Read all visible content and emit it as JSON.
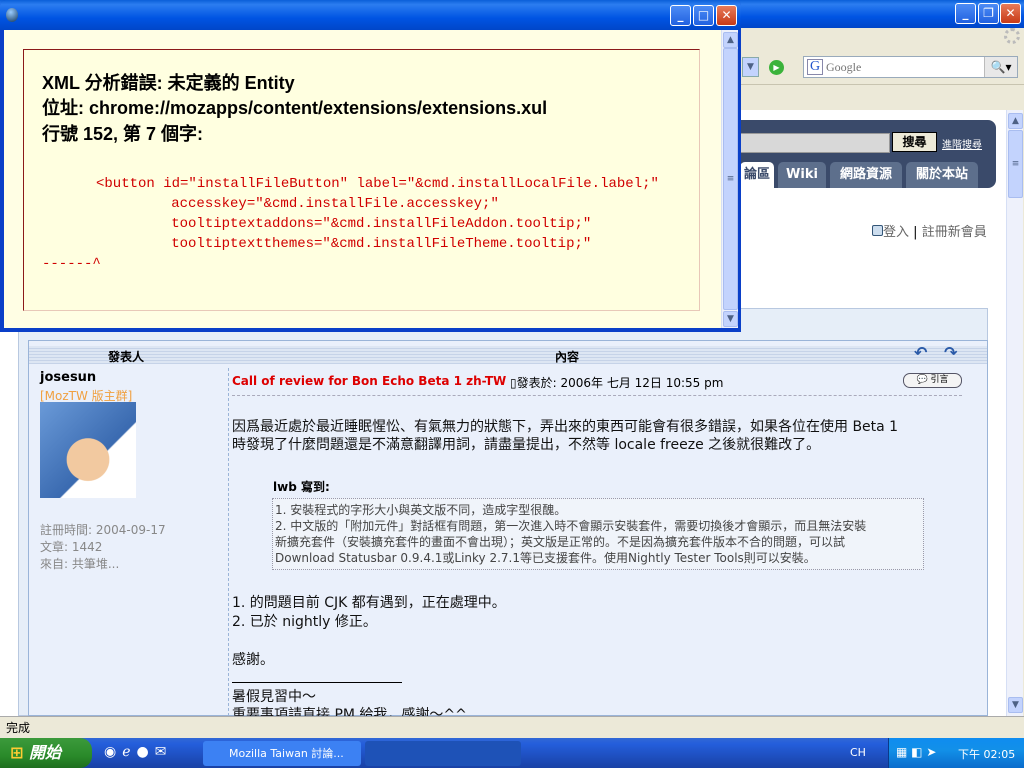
{
  "browser": {
    "search_placeholder": "Google",
    "status_text": "完成"
  },
  "site": {
    "search_button": "搜尋",
    "advanced_search": "進階搜尋",
    "tabs": [
      "論區",
      "Wiki",
      "網路資源",
      "關於本站"
    ],
    "login": "登入",
    "separator": "|",
    "register": "註冊新會員"
  },
  "forum": {
    "col_author": "發表人",
    "col_content": "內容",
    "author": {
      "name": "josesun",
      "rank": "[MozTW 版主群]",
      "joined": "註冊時間: 2004-09-17",
      "posts": "文章: 1442",
      "location": "來自: 共筆堆..."
    },
    "post": {
      "title": "Call of review for Bon Echo Beta 1 zh-TW",
      "posted": "發表於: 2006年 七月 12日 10:55 pm",
      "quote_button": "引言",
      "body": [
        "因爲最近處於最近睡眠惺忪、有氣無力的狀態下，弄出來的東西可能會有很多錯誤，如果各位在使用 Beta 1",
        "時發現了什麼問題還是不滿意翻譯用詞，請盡量提出，不然等 locale freeze 之後就很難改了。"
      ],
      "quote_author": "lwb 寫到:",
      "quote_lines": [
        "1. 安裝程式的字形大小與英文版不同，造成字型很醜。",
        "2. 中文版的「附加元件」對話框有問題，第一次進入時不會顯示安裝套件，需要切換後才會顯示，而且無法安裝",
        "新擴充套件（安裝擴充套件的畫面不會出現）；英文版是正常的。不是因為擴充套件版本不合的問題，可以試",
        "Download Statusbar 0.9.4.1或Linky 2.7.1等已支援套件。使用Nightly Tester Tools則可以安裝。"
      ],
      "reply_lines": [
        "1. 的問題目前 CJK 都有遇到，正在處理中。",
        "2. 已於 nightly 修正。"
      ],
      "thanks": "感謝。",
      "signature": [
        "暑假見習中～",
        "重要事項請直接 PM 給我，感謝～^^"
      ]
    }
  },
  "dialog": {
    "error_title": "XML 分析錯誤: 未定義的 Entity",
    "location": "位址: chrome://mozapps/content/extensions/extensions.xul",
    "line_info": "行號 152, 第 7 個字:",
    "code_lines": [
      "<button id=\"installFileButton\" label=\"&cmd.installLocalFile.label;\"",
      "        accesskey=\"&cmd.installFile.accesskey;\"",
      "        tooltiptextaddons=\"&cmd.installFileAddon.tooltip;\"",
      "        tooltiptextthemes=\"&cmd.installFileTheme.tooltip;\""
    ],
    "pointer": "------^"
  },
  "taskbar": {
    "start": "開始",
    "tasks": [
      "Mozilla Taiwan 討論...",
      ""
    ],
    "lang": "CH",
    "clock": "下午 02:05"
  }
}
